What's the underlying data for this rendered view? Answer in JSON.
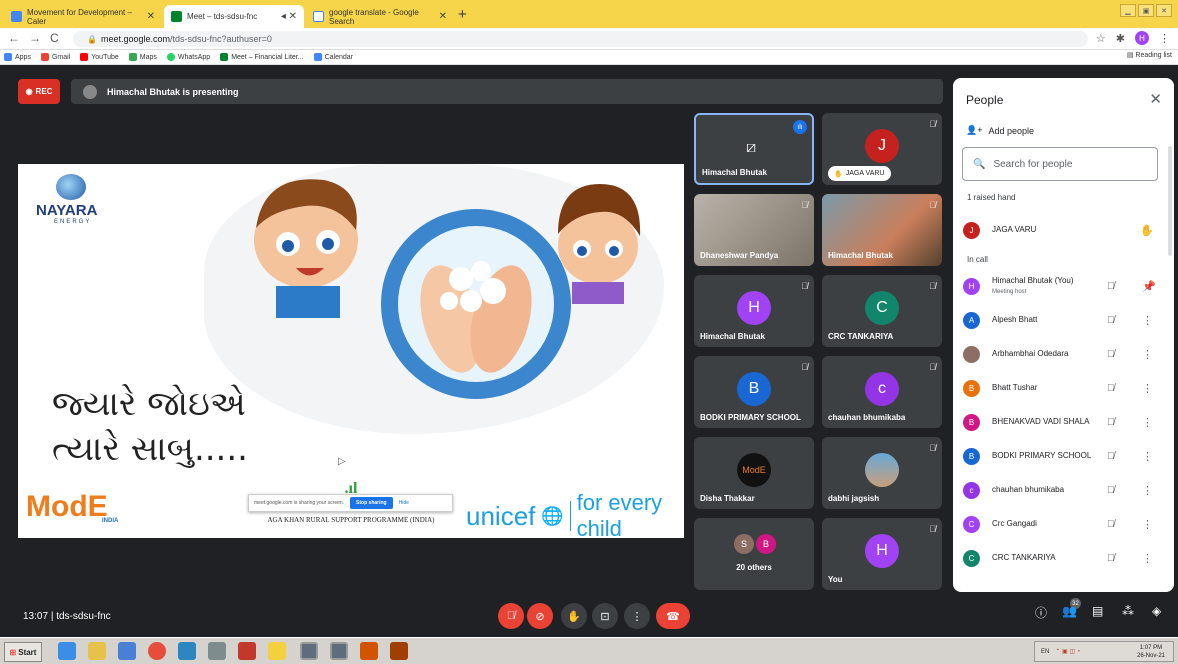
{
  "browser": {
    "tabs": [
      {
        "title": "Movement for Development – Caler",
        "active": false
      },
      {
        "title": "Meet – tds-sdsu-fnc",
        "active": true
      },
      {
        "title": "google translate - Google Search",
        "active": false
      }
    ],
    "new_tab": "+",
    "url_host": "meet.google.com",
    "url_path": "/tds-sdsu-fnc?authuser=0",
    "profile_initial": "H",
    "bookmarks": [
      "Apps",
      "Gmail",
      "YouTube",
      "Maps",
      "WhatsApp",
      "Meet – Financial Liter...",
      "Calendar"
    ],
    "reading_list": "Reading list"
  },
  "meet": {
    "rec_label": "REC",
    "presenting_text": "Himachal Bhutak is presenting",
    "meeting_time": "13:07",
    "meeting_code": "tds-sdsu-fnc",
    "participants_count": "32"
  },
  "slide": {
    "brand_name": "NAYARA",
    "brand_sub": "ENERGY",
    "gujarati_line1": "જ્યારે જોઇએ",
    "gujarati_line2": "ત્યારે સાબુ.....",
    "mode_logo": "ModE",
    "mode_sub": "INDIA",
    "aga_khan": "AGA KHAN RURAL SUPPORT PROGRAMME (INDIA)",
    "unicef": "unicef",
    "for_every_child": "for every child",
    "share_notice": "meet.google.com is sharing your screen.",
    "stop_sharing": "Stop sharing",
    "hide": "Hide"
  },
  "tiles": [
    {
      "name": "Himachal Bhutak",
      "kind": "presenting"
    },
    {
      "name": "JAGA VARU",
      "initial": "J",
      "color": "#c5221f",
      "kind": "hand"
    },
    {
      "name": "Dhaneshwar Pandya",
      "kind": "video"
    },
    {
      "name": "Himachal Bhutak",
      "kind": "video"
    },
    {
      "name": "Himachal Bhutak",
      "initial": "H",
      "color": "#a142f4"
    },
    {
      "name": "CRC TANKARIYA",
      "initial": "C",
      "color": "#12866a"
    },
    {
      "name": "BODKI PRIMARY SCHOOL",
      "initial": "B",
      "color": "#1967d2"
    },
    {
      "name": "chauhan bhumikaba",
      "initial": "c",
      "color": "#9334e6"
    },
    {
      "name": "Disha Thakkar",
      "kind": "logo"
    },
    {
      "name": "dabhi jagsish",
      "kind": "photo"
    },
    {
      "name": "20 others",
      "initial_a": "S",
      "initial_b": "B",
      "kind": "others"
    },
    {
      "name": "You",
      "initial": "H",
      "color": "#a142f4"
    }
  ],
  "people": {
    "title": "People",
    "add_people": "Add people",
    "search_placeholder": "Search for people",
    "raised_header": "1 raised hand",
    "in_call_header": "In call",
    "raised": [
      {
        "name": "JAGA VARU",
        "initial": "J",
        "color": "#c5221f"
      }
    ],
    "in_call": [
      {
        "name": "Himachal Bhutak (You)",
        "sub": "Meeting host",
        "initial": "H",
        "color": "#a142f4"
      },
      {
        "name": "Alpesh Bhatt",
        "initial": "A",
        "color": "#1967d2"
      },
      {
        "name": "Arbhambhai Odedara",
        "initial": "",
        "color": "#8d6e63"
      },
      {
        "name": "Bhatt Tushar",
        "initial": "B",
        "color": "#e8710a"
      },
      {
        "name": "BHENAKVAD VADI SHALA",
        "initial": "B",
        "color": "#d01884"
      },
      {
        "name": "BODKI PRIMARY SCHOOL",
        "initial": "B",
        "color": "#1967d2"
      },
      {
        "name": "chauhan bhumikaba",
        "initial": "c",
        "color": "#9334e6"
      },
      {
        "name": "Crc Gangadi",
        "initial": "C",
        "color": "#a142f4"
      },
      {
        "name": "CRC TANKARIYA",
        "initial": "C",
        "color": "#12866a"
      }
    ]
  },
  "taskbar": {
    "start": "Start",
    "lang": "EN",
    "time": "1:07 PM",
    "date": "26-Nov-21"
  }
}
